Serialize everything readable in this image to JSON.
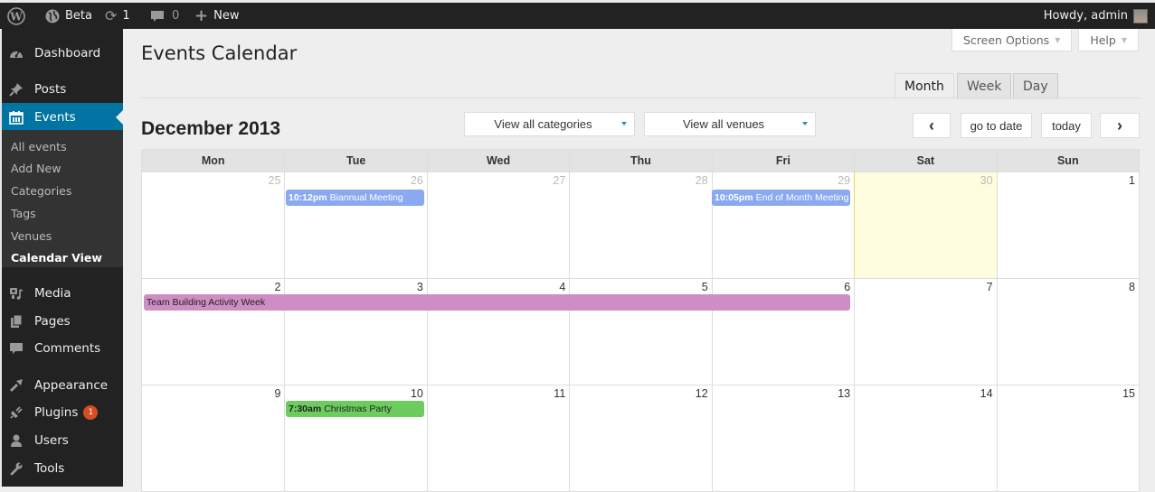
{
  "adminbar": {
    "site_name": "Beta",
    "updates_count": "1",
    "comments_count": "0",
    "new_label": "New",
    "howdy": "Howdy, admin"
  },
  "sidebar": {
    "items": [
      {
        "label": "Dashboard",
        "icon": "dashboard-icon"
      },
      {
        "label": "Posts",
        "icon": "pin-icon"
      },
      {
        "label": "Events",
        "icon": "calendar-icon"
      },
      {
        "label": "Media",
        "icon": "media-icon"
      },
      {
        "label": "Pages",
        "icon": "pages-icon"
      },
      {
        "label": "Comments",
        "icon": "comment-icon"
      },
      {
        "label": "Appearance",
        "icon": "brush-icon"
      },
      {
        "label": "Plugins",
        "icon": "plug-icon",
        "badge": "1"
      },
      {
        "label": "Users",
        "icon": "user-icon"
      },
      {
        "label": "Tools",
        "icon": "wrench-icon"
      }
    ],
    "events_submenu": [
      "All events",
      "Add New",
      "Categories",
      "Tags",
      "Venues",
      "Calendar View"
    ]
  },
  "screen_meta": {
    "screen_options": "Screen Options",
    "help": "Help"
  },
  "page": {
    "title": "Events Calendar",
    "view_tabs": [
      "Month",
      "Week",
      "Day"
    ],
    "active_tab": "Month"
  },
  "calendar": {
    "month_title": "December 2013",
    "filters": {
      "categories": "View all categories",
      "venues": "View all venues"
    },
    "nav": {
      "prev": "‹",
      "goto": "go to date",
      "today": "today",
      "next": "›"
    },
    "days_of_week": [
      "Mon",
      "Tue",
      "Wed",
      "Thu",
      "Fri",
      "Sat",
      "Sun"
    ],
    "weeks": [
      [
        "25",
        "26",
        "27",
        "28",
        "29",
        "30",
        "1"
      ],
      [
        "2",
        "3",
        "4",
        "5",
        "6",
        "7",
        "8"
      ],
      [
        "9",
        "10",
        "11",
        "12",
        "13",
        "14",
        "15"
      ]
    ],
    "events": {
      "biannual": {
        "time": "10:12pm",
        "title": "Biannual Meeting",
        "color": "#8aa9f0"
      },
      "end_of_month": {
        "time": "10:05pm",
        "title": "End of Month Meeting",
        "color": "#8aa9f0"
      },
      "team_building": {
        "title": "Team Building Activity Week",
        "color": "#cf8ec3"
      },
      "christmas": {
        "time": "7:30am",
        "title": "Christmas Party",
        "color": "#6ccc5e"
      }
    }
  }
}
